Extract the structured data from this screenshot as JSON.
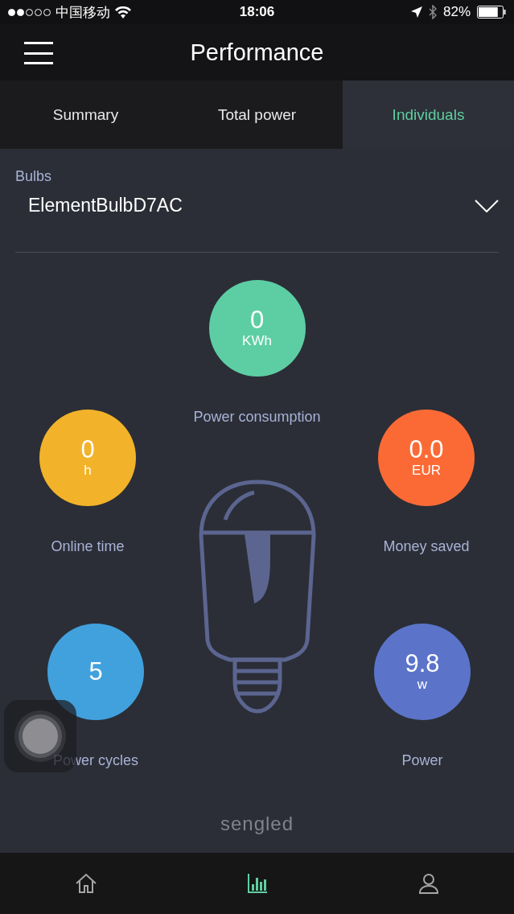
{
  "status_bar": {
    "carrier": "中国移动",
    "time": "18:06",
    "battery": "82%"
  },
  "header": {
    "title": "Performance"
  },
  "tabs": [
    {
      "label": "Summary",
      "selected": false
    },
    {
      "label": "Total power",
      "selected": false
    },
    {
      "label": "Individuals",
      "selected": true
    }
  ],
  "device_select": {
    "label": "Bulbs",
    "value": "ElementBulbD7AC"
  },
  "metrics": [
    {
      "value": "0",
      "unit": "KWh",
      "caption": "Power consumption",
      "color": "#5dcea4"
    },
    {
      "value": "0",
      "unit": "h",
      "caption": "Online time",
      "color": "#f2b32a"
    },
    {
      "value": "0.0",
      "unit": "EUR",
      "caption": "Money saved",
      "color": "#fb6a35"
    },
    {
      "value": "5",
      "caption": "Power cycles",
      "color": "#41a1dd"
    },
    {
      "value": "9.8",
      "unit": "w",
      "caption": "Power",
      "color": "#5b74c9"
    }
  ],
  "brand": "sengled",
  "bottom_nav": [
    {
      "kind": "home",
      "selected": false
    },
    {
      "kind": "chart",
      "selected": true
    },
    {
      "kind": "profile",
      "selected": false
    }
  ]
}
